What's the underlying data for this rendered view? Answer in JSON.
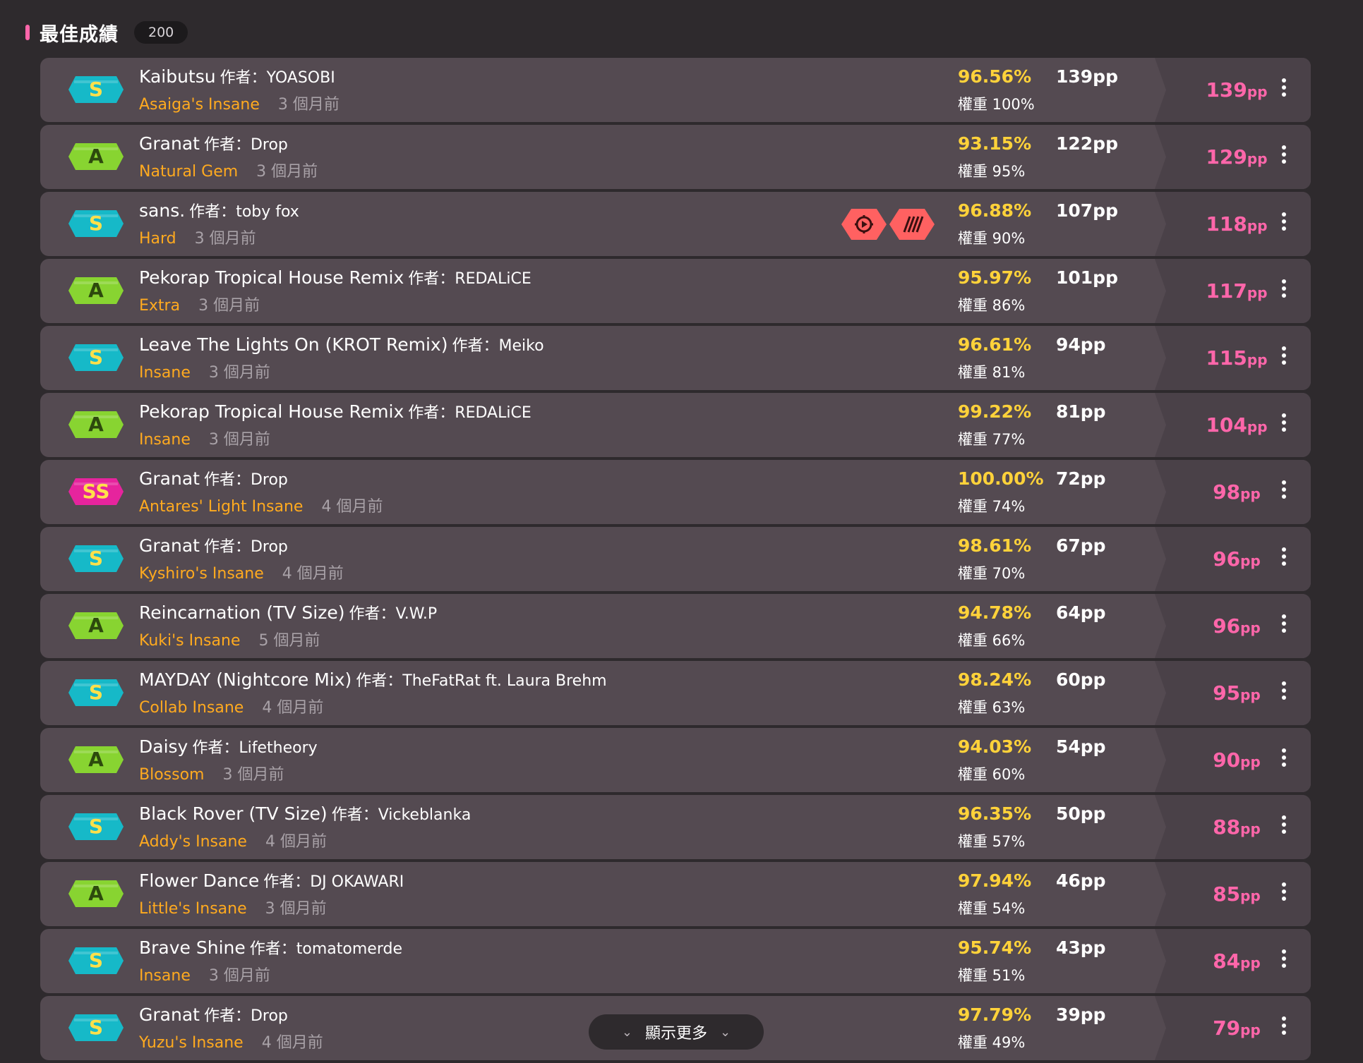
{
  "section": {
    "title": "最佳成績",
    "count": "200"
  },
  "grade_colors": {
    "S": {
      "bg": "#16b9c8",
      "fg": "#ffe04a"
    },
    "A": {
      "bg": "#88d431",
      "fg": "#2d4a0d"
    },
    "SS": {
      "bg": "#e6249d",
      "fg": "#ffe04a"
    }
  },
  "by_label": "作者：",
  "scores": [
    {
      "grade": "S",
      "title": "Kaibutsu",
      "artist": "YOASOBI",
      "diff": "Asaiga's Insane",
      "time": "3 個月前",
      "acc": "96.56%",
      "weight": "權重 100%",
      "raw_pp": "139pp",
      "pp": "139",
      "unit": "pp"
    },
    {
      "grade": "A",
      "title": "Granat",
      "artist": "Drop",
      "diff": "Natural Gem",
      "time": "3 個月前",
      "acc": "93.15%",
      "weight": "權重 95%",
      "raw_pp": "122pp",
      "pp": "129",
      "unit": "pp"
    },
    {
      "grade": "S",
      "title": "sans.",
      "artist": "toby fox",
      "diff": "Hard",
      "time": "3 個月前",
      "acc": "96.88%",
      "weight": "權重 90%",
      "raw_pp": "107pp",
      "pp": "118",
      "unit": "pp",
      "mods": [
        "auto-icon",
        "stripes-icon"
      ]
    },
    {
      "grade": "A",
      "title": "Pekorap Tropical House Remix",
      "artist": "REDALiCE",
      "diff": "Extra",
      "time": "3 個月前",
      "acc": "95.97%",
      "weight": "權重 86%",
      "raw_pp": "101pp",
      "pp": "117",
      "unit": "pp"
    },
    {
      "grade": "S",
      "title": "Leave The Lights On (KROT Remix)",
      "artist": "Meiko",
      "diff": "Insane",
      "time": "3 個月前",
      "acc": "96.61%",
      "weight": "權重 81%",
      "raw_pp": "94pp",
      "pp": "115",
      "unit": "pp"
    },
    {
      "grade": "A",
      "title": "Pekorap Tropical House Remix",
      "artist": "REDALiCE",
      "diff": "Insane",
      "time": "3 個月前",
      "acc": "99.22%",
      "weight": "權重 77%",
      "raw_pp": "81pp",
      "pp": "104",
      "unit": "pp"
    },
    {
      "grade": "SS",
      "title": "Granat",
      "artist": "Drop",
      "diff": "Antares' Light Insane",
      "time": "4 個月前",
      "acc": "100.00%",
      "weight": "權重 74%",
      "raw_pp": "72pp",
      "pp": "98",
      "unit": "pp"
    },
    {
      "grade": "S",
      "title": "Granat",
      "artist": "Drop",
      "diff": "Kyshiro's Insane",
      "time": "4 個月前",
      "acc": "98.61%",
      "weight": "權重 70%",
      "raw_pp": "67pp",
      "pp": "96",
      "unit": "pp"
    },
    {
      "grade": "A",
      "title": "Reincarnation (TV Size)",
      "artist": "V.W.P",
      "diff": "Kuki's Insane",
      "time": "5 個月前",
      "acc": "94.78%",
      "weight": "權重 66%",
      "raw_pp": "64pp",
      "pp": "96",
      "unit": "pp"
    },
    {
      "grade": "S",
      "title": "MAYDAY (Nightcore Mix)",
      "artist": "TheFatRat ft. Laura Brehm",
      "diff": "Collab Insane",
      "time": "4 個月前",
      "acc": "98.24%",
      "weight": "權重 63%",
      "raw_pp": "60pp",
      "pp": "95",
      "unit": "pp"
    },
    {
      "grade": "A",
      "title": "Daisy",
      "artist": "Lifetheory",
      "diff": "Blossom",
      "time": "3 個月前",
      "acc": "94.03%",
      "weight": "權重 60%",
      "raw_pp": "54pp",
      "pp": "90",
      "unit": "pp"
    },
    {
      "grade": "S",
      "title": "Black Rover (TV Size)",
      "artist": "Vickeblanka",
      "diff": "Addy's Insane",
      "time": "4 個月前",
      "acc": "96.35%",
      "weight": "權重 57%",
      "raw_pp": "50pp",
      "pp": "88",
      "unit": "pp"
    },
    {
      "grade": "A",
      "title": "Flower Dance",
      "artist": "DJ OKAWARI",
      "diff": "Little's Insane",
      "time": "3 個月前",
      "acc": "97.94%",
      "weight": "權重 54%",
      "raw_pp": "46pp",
      "pp": "85",
      "unit": "pp"
    },
    {
      "grade": "S",
      "title": "Brave Shine",
      "artist": "tomatomerde",
      "diff": "Insane",
      "time": "3 個月前",
      "acc": "95.74%",
      "weight": "權重 51%",
      "raw_pp": "43pp",
      "pp": "84",
      "unit": "pp"
    },
    {
      "grade": "S",
      "title": "Granat",
      "artist": "Drop",
      "diff": "Yuzu's Insane",
      "time": "4 個月前",
      "acc": "97.79%",
      "weight": "權重 49%",
      "raw_pp": "39pp",
      "pp": "79",
      "unit": "pp"
    }
  ],
  "show_more": {
    "label": "顯示更多",
    "icon": "chevron-down-icon"
  }
}
